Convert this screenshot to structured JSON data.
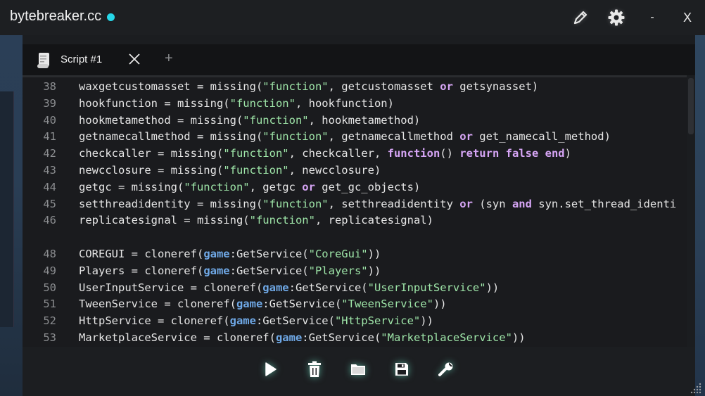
{
  "window": {
    "title": "bytebreaker.cc",
    "status_color": "#26d6e8",
    "minimize_label": "-",
    "close_label": "X"
  },
  "tabs": [
    {
      "label": "Script #1",
      "icon": "scroll-icon"
    }
  ],
  "tab_add_label": "+",
  "editor": {
    "lines": [
      {
        "num": "38",
        "text": "waxgetcustomasset = missing(\"function\", getcustomasset or getsynasset)"
      },
      {
        "num": "39",
        "text": "hookfunction = missing(\"function\", hookfunction)"
      },
      {
        "num": "40",
        "text": "hookmetamethod = missing(\"function\", hookmetamethod)"
      },
      {
        "num": "41",
        "text": "getnamecallmethod = missing(\"function\", getnamecallmethod or get_namecall_method)"
      },
      {
        "num": "42",
        "text": "checkcaller = missing(\"function\", checkcaller, function() return false end)"
      },
      {
        "num": "43",
        "text": "newcclosure = missing(\"function\", newcclosure)"
      },
      {
        "num": "44",
        "text": "getgc = missing(\"function\", getgc or get_gc_objects)"
      },
      {
        "num": "45",
        "text": "setthreadidentity = missing(\"function\", setthreadidentity or (syn and syn.set_thread_identi"
      },
      {
        "num": "46",
        "text": "replicatesignal = missing(\"function\", replicatesignal)"
      },
      {
        "num": "",
        "text": ""
      },
      {
        "num": "48",
        "text": "COREGUI = cloneref(game:GetService(\"CoreGui\"))"
      },
      {
        "num": "49",
        "text": "Players = cloneref(game:GetService(\"Players\"))"
      },
      {
        "num": "50",
        "text": "UserInputService = cloneref(game:GetService(\"UserInputService\"))"
      },
      {
        "num": "51",
        "text": "TweenService = cloneref(game:GetService(\"TweenService\"))"
      },
      {
        "num": "52",
        "text": "HttpService = cloneref(game:GetService(\"HttpService\"))"
      },
      {
        "num": "53",
        "text": "MarketplaceService = cloneref(game:GetService(\"MarketplaceService\"))"
      }
    ]
  },
  "toolbar": {
    "items": [
      "play-icon",
      "trash-icon",
      "folder-icon",
      "save-icon",
      "wrench-icon"
    ]
  },
  "colors": {
    "keyword": "#d6a5f5",
    "string": "#9ee5a8",
    "global": "#6fa8e6",
    "text": "#e6e6e6",
    "line_number": "#8b8d90",
    "tool_glow": "#78ffdc"
  }
}
